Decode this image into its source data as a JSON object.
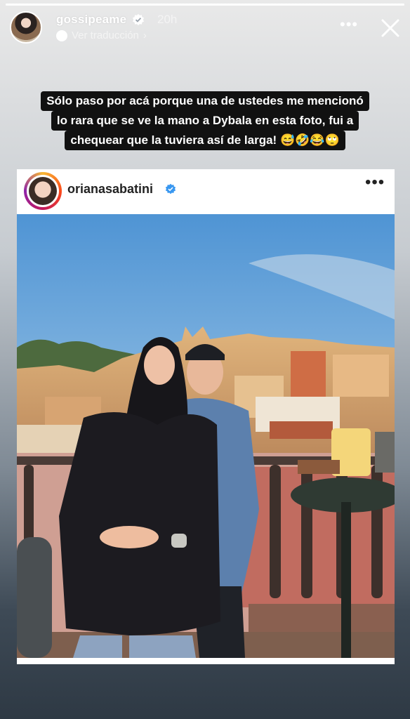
{
  "story": {
    "progress": 1.0,
    "username": "gossipeame",
    "time": "20h",
    "translate_label": "Ver traducción",
    "translate_chevron": "›",
    "more_icon": "more-horizontal-icon",
    "close_icon": "close-icon"
  },
  "caption": {
    "lines": [
      "Sólo paso por acá porque una de ustedes me mencionó",
      "lo rara que se ve la mano a Dybala en esta foto, fui a",
      "chequear que la tuviera así de larga! 😅🤣😂🙄"
    ]
  },
  "post": {
    "username": "orianasabatini",
    "verified_color": "#3897f0",
    "more_label": "•••"
  },
  "colors": {
    "sky": "#9ec6e6",
    "caption_bg": "#111111"
  }
}
